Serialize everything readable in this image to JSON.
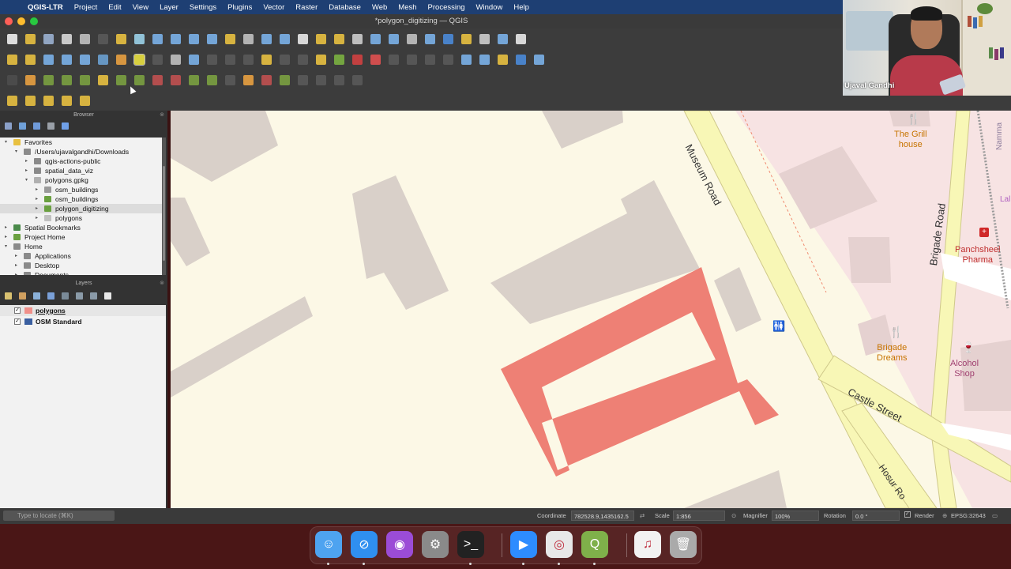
{
  "menubar": {
    "app": "QGIS-LTR",
    "menus": [
      "Project",
      "Edit",
      "View",
      "Layer",
      "Settings",
      "Plugins",
      "Vector",
      "Raster",
      "Database",
      "Web",
      "Mesh",
      "Processing",
      "Window",
      "Help"
    ]
  },
  "window": {
    "title": "*polygon_digitizing — QGIS"
  },
  "webcam": {
    "name": "Ujaval Gandhi"
  },
  "browser": {
    "title": "Browser",
    "items": [
      {
        "label": "Favorites",
        "depth": 0,
        "icon": "star-icon",
        "expanded": true
      },
      {
        "label": "/Users/ujavalgandhi/Downloads",
        "depth": 1,
        "icon": "folder-icon",
        "expanded": true
      },
      {
        "label": "qgis-actions-public",
        "depth": 2,
        "icon": "folder-icon",
        "expanded": false
      },
      {
        "label": "spatial_data_viz",
        "depth": 2,
        "icon": "folder-icon",
        "expanded": false
      },
      {
        "label": "polygons.gpkg",
        "depth": 2,
        "icon": "geopackage-icon",
        "expanded": true
      },
      {
        "label": "osm_buildings",
        "depth": 3,
        "icon": "table-icon",
        "expanded": false
      },
      {
        "label": "osm_buildings",
        "depth": 3,
        "icon": "qgis-project-icon",
        "expanded": false
      },
      {
        "label": "polygon_digitizing",
        "depth": 3,
        "icon": "qgis-project-icon",
        "expanded": false,
        "selected": true
      },
      {
        "label": "polygons",
        "depth": 3,
        "icon": "polygon-layer-icon",
        "expanded": false
      },
      {
        "label": "Spatial Bookmarks",
        "depth": 0,
        "icon": "bookmark-icon",
        "expanded": false
      },
      {
        "label": "Project Home",
        "depth": 0,
        "icon": "project-home-icon",
        "expanded": false
      },
      {
        "label": "Home",
        "depth": 0,
        "icon": "home-icon",
        "expanded": true
      },
      {
        "label": "Applications",
        "depth": 1,
        "icon": "folder-icon",
        "expanded": false
      },
      {
        "label": "Desktop",
        "depth": 1,
        "icon": "folder-icon",
        "expanded": false
      },
      {
        "label": "Documents",
        "depth": 1,
        "icon": "folder-icon",
        "expanded": false
      }
    ]
  },
  "layers": {
    "title": "Layers",
    "items": [
      {
        "label": "polygons",
        "checked": true,
        "selected": true,
        "icon": "polygon-layer-icon",
        "color": "#f0908a"
      },
      {
        "label": "OSM Standard",
        "checked": true,
        "selected": false,
        "icon": "tile-layer-icon",
        "color": "#3a5fa0"
      }
    ]
  },
  "map_labels": {
    "museum_road": "Museum Road",
    "brigade_road": "Brigade Road",
    "castle_street": "Castle Street",
    "hosur_road": "Hosur Ro",
    "grill_house": "The Grill\nhouse",
    "brigade_dreams": "Brigade\nDreams",
    "alcohol_shop": "Alcohol\nShop",
    "panchsheel": "Panchsheel\nPharma",
    "namma": "Namma",
    "lalu": "Lalu"
  },
  "colors": {
    "map_bg": "#fcf8e6",
    "building": "#d9d0c9",
    "polygon": "#ee8075",
    "road": "#f8f7b6",
    "road_edge": "#cfc88a",
    "pink_area": "#f7e3e3",
    "poi": "#c77400"
  },
  "status": {
    "locate_placeholder": "Type to locate (⌘K)",
    "coordinate_label": "Coordinate",
    "coordinate": "782528.9,1435162.5",
    "scale_label": "Scale",
    "scale": "1:856",
    "magnifier_label": "Magnifier",
    "magnifier": "100%",
    "rotation_label": "Rotation",
    "rotation": "0.0 °",
    "render_label": "Render",
    "crs": "EPSG:32643"
  },
  "dock": {
    "apps": [
      {
        "name": "finder-icon",
        "color": "#4ea3f0",
        "glyph": "☺",
        "running": true
      },
      {
        "name": "safari-icon",
        "color": "#2f8ff0",
        "glyph": "⊘",
        "running": true
      },
      {
        "name": "podcasts-icon",
        "color": "#9b4cd6",
        "glyph": "◉",
        "running": false
      },
      {
        "name": "system-preferences-icon",
        "color": "#8a8a8a",
        "glyph": "⚙",
        "running": false
      },
      {
        "name": "terminal-icon",
        "color": "#222222",
        "glyph": ">_",
        "running": true
      },
      {
        "name": "zoom-icon",
        "color": "#2d8cff",
        "glyph": "▶",
        "running": true
      },
      {
        "name": "chrome-icon",
        "color": "#e8e8e8",
        "glyph": "◎",
        "running": true
      },
      {
        "name": "qgis-icon",
        "color": "#7fb04a",
        "glyph": "Q",
        "running": true
      },
      {
        "name": "music-icon",
        "color": "#f2f2f2",
        "glyph": "♫",
        "running": false
      },
      {
        "name": "trash-icon",
        "color": "#aaaaaa",
        "glyph": "🗑",
        "running": false
      }
    ]
  }
}
